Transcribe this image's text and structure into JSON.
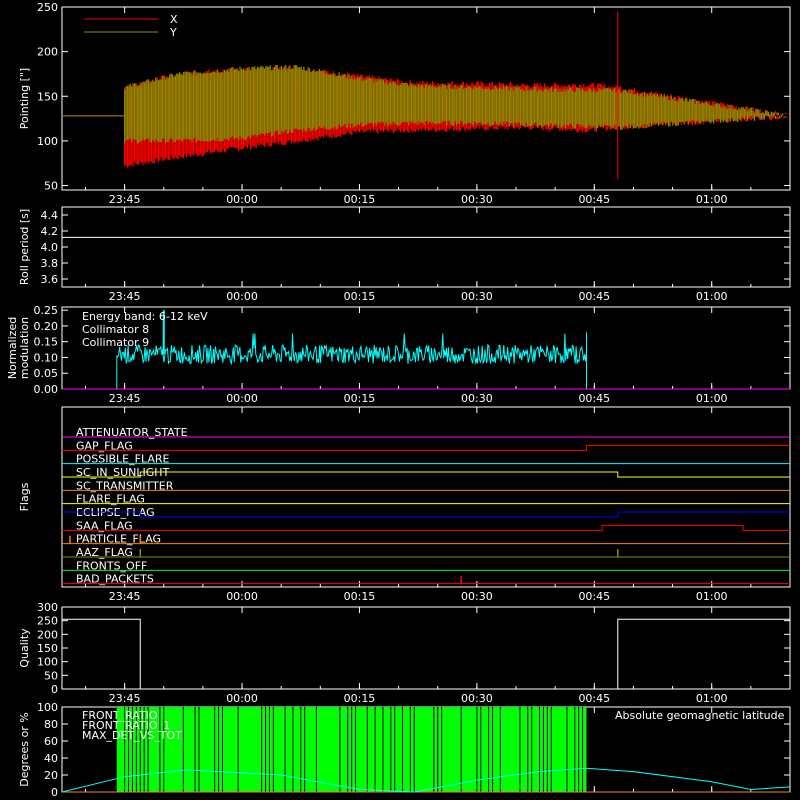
{
  "colors": {
    "background": "#000000",
    "axes": "#ffffff",
    "red": "#ff0000",
    "olive": "#8a8a00",
    "cyan": "#00ffff",
    "magenta": "#ff00ff",
    "green": "#00ff00",
    "yellow": "#ffff00",
    "orange": "#ff8000",
    "blue": "#0000ff",
    "white": "#ffffff"
  },
  "time_ticks": [
    "23:45",
    "00:00",
    "00:15",
    "00:30",
    "00:45",
    "01:00"
  ],
  "chart_data": [
    {
      "type": "line",
      "ylabel": "Pointing [\"]",
      "ylim": [
        45,
        250
      ],
      "yticks": [
        50,
        100,
        150,
        200,
        250
      ],
      "x_range": [
        "23:37",
        "01:10"
      ],
      "series": [
        {
          "name": "X",
          "color": "#ff0000",
          "points": [
            {
              "t": "23:37",
              "min": 128,
              "max": 128
            },
            {
              "t": "23:45",
              "min": 72,
              "max": 160
            },
            {
              "t": "23:52",
              "min": 82,
              "max": 175
            },
            {
              "t": "00:00",
              "min": 92,
              "max": 180
            },
            {
              "t": "00:07",
              "min": 100,
              "max": 182
            },
            {
              "t": "00:15",
              "min": 110,
              "max": 172
            },
            {
              "t": "00:22",
              "min": 112,
              "max": 165
            },
            {
              "t": "00:30",
              "min": 114,
              "max": 164
            },
            {
              "t": "00:37",
              "min": 115,
              "max": 162
            },
            {
              "t": "00:44",
              "min": 112,
              "max": 163
            },
            {
              "t": "00:48",
              "min": 115,
              "max": 160
            },
            {
              "t": "01:10",
              "min": 128,
              "max": 128
            }
          ]
        },
        {
          "name": "Y",
          "color": "#8a8a00",
          "points": [
            {
              "t": "23:37",
              "min": 128,
              "max": 128
            },
            {
              "t": "23:45",
              "min": 100,
              "max": 160
            },
            {
              "t": "23:52",
              "min": 100,
              "max": 175
            },
            {
              "t": "00:00",
              "min": 103,
              "max": 181
            },
            {
              "t": "00:07",
              "min": 112,
              "max": 183
            },
            {
              "t": "00:15",
              "min": 118,
              "max": 170
            },
            {
              "t": "00:22",
              "min": 120,
              "max": 162
            },
            {
              "t": "00:30",
              "min": 120,
              "max": 160
            },
            {
              "t": "00:37",
              "min": 118,
              "max": 158
            },
            {
              "t": "00:44",
              "min": 116,
              "max": 157
            },
            {
              "t": "00:48",
              "min": 115,
              "max": 157
            },
            {
              "t": "01:10",
              "min": 128,
              "max": 128
            }
          ]
        }
      ]
    },
    {
      "type": "line",
      "ylabel": "Roll period [s]",
      "ylim": [
        3.5,
        4.5
      ],
      "yticks": [
        3.6,
        3.8,
        4.0,
        4.2,
        4.4
      ],
      "series": [
        {
          "name": "",
          "color": "#ffffff",
          "x": [
            "23:37",
            "01:10"
          ],
          "values": [
            4.12,
            4.12
          ]
        }
      ]
    },
    {
      "type": "line",
      "ylabel": "Normalized modulation",
      "ylim": [
        0,
        0.26
      ],
      "yticks": [
        0.0,
        0.05,
        0.1,
        0.15,
        0.2,
        0.25
      ],
      "annotation": "Energy band: 6-12 keV",
      "series": [
        {
          "name": "Collimator 8",
          "color": "#00ffff",
          "x_range": [
            "23:44",
            "00:44"
          ],
          "mean": 0.11,
          "spread": 0.03,
          "peak": 0.25
        },
        {
          "name": "Collimator 9",
          "color": "#ff00ff",
          "x_range": [
            "23:37",
            "01:10"
          ],
          "mean": 0.0
        }
      ]
    },
    {
      "type": "table",
      "ylabel": "Flags",
      "flags": [
        {
          "name": "ATTENUATOR_STATE",
          "color": "#ff00ff",
          "steps": []
        },
        {
          "name": "GAP_FLAG",
          "color": "#ff0000",
          "steps": [
            [
              "00:44",
              1
            ]
          ]
        },
        {
          "name": "POSSIBLE_FLARE",
          "color": "#00ffff",
          "steps": []
        },
        {
          "name": "SC_IN_SUNLIGHT",
          "color": "#ffff00",
          "steps": [
            [
              "23:47",
              1
            ],
            [
              "00:48",
              0
            ]
          ]
        },
        {
          "name": "SC_TRANSMITTER",
          "color": "#ff8000",
          "steps": []
        },
        {
          "name": "FLARE_FLAG",
          "color": "#ffff00",
          "steps": []
        },
        {
          "name": "ECLIPSE_FLAG",
          "color": "#0000ff",
          "steps": [
            [
              "23:47",
              0
            ],
            [
              "00:48",
              1
            ]
          ]
        },
        {
          "name": "SAA_FLAG",
          "color": "#ff0000",
          "steps": [
            [
              "00:46",
              1
            ],
            [
              "01:04",
              0
            ]
          ]
        },
        {
          "name": "PARTICLE_FLAG",
          "color": "#ff8000",
          "spikes": [
            "23:37",
            "23:47"
          ]
        },
        {
          "name": "AAZ_FLAG",
          "color": "#8a8a00",
          "spikes": [
            "23:47",
            "00:48"
          ]
        },
        {
          "name": "FRONTS_OFF",
          "color": "#00ff00",
          "steps": []
        },
        {
          "name": "BAD_PACKETS",
          "color": "#ff0000",
          "spikes": [
            "00:28"
          ]
        }
      ]
    },
    {
      "type": "line",
      "ylabel": "Quality",
      "ylim": [
        0,
        300
      ],
      "yticks": [
        0,
        50,
        100,
        150,
        200,
        250,
        300
      ],
      "series": [
        {
          "name": "",
          "color": "#ffffff",
          "steps": [
            [
              "23:37",
              255
            ],
            [
              "23:47",
              0
            ],
            [
              "00:48",
              255
            ]
          ]
        }
      ]
    },
    {
      "type": "line",
      "ylabel": "Degrees or %",
      "ylim": [
        0,
        100
      ],
      "yticks": [
        0,
        20,
        40,
        60,
        80,
        100
      ],
      "series": [
        {
          "name": "FRONT_RATIO",
          "color": "#ffff00"
        },
        {
          "name": "FRONT_RATIO_1",
          "color": "#00ff00",
          "x_range": [
            "23:44",
            "00:44"
          ],
          "value": 100
        },
        {
          "name": "MAX_DET_VS_TOT",
          "color": "#ff8000"
        }
      ],
      "latitude": {
        "name": "Absolute geomagnetic latitude",
        "color": "#00ffff",
        "points": [
          [
            "23:37",
            0
          ],
          [
            "23:45",
            18
          ],
          [
            "23:53",
            26
          ],
          [
            "00:05",
            20
          ],
          [
            "00:15",
            3
          ],
          [
            "00:22",
            0
          ],
          [
            "00:30",
            14
          ],
          [
            "00:38",
            24
          ],
          [
            "00:44",
            28
          ],
          [
            "00:50",
            24
          ],
          [
            "01:00",
            12
          ],
          [
            "01:05",
            3
          ],
          [
            "01:10",
            6
          ]
        ]
      }
    }
  ]
}
